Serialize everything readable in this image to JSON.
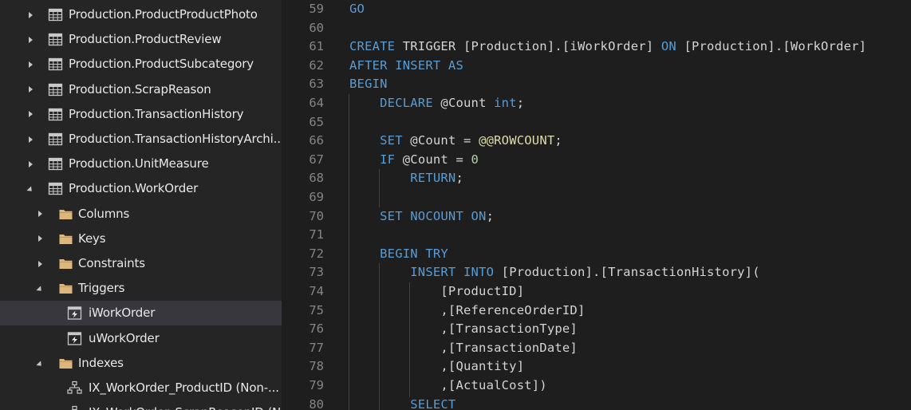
{
  "sidebar": {
    "items": [
      {
        "label": "Production.ProductProductPhoto",
        "icon": "table-icon",
        "expander": "collapsed",
        "level": 0
      },
      {
        "label": "Production.ProductReview",
        "icon": "table-icon",
        "expander": "collapsed",
        "level": 0
      },
      {
        "label": "Production.ProductSubcategory",
        "icon": "table-icon",
        "expander": "collapsed",
        "level": 0
      },
      {
        "label": "Production.ScrapReason",
        "icon": "table-icon",
        "expander": "collapsed",
        "level": 0
      },
      {
        "label": "Production.TransactionHistory",
        "icon": "table-icon",
        "expander": "collapsed",
        "level": 0
      },
      {
        "label": "Production.TransactionHistoryArchi...",
        "icon": "table-icon",
        "expander": "collapsed",
        "level": 0
      },
      {
        "label": "Production.UnitMeasure",
        "icon": "table-icon",
        "expander": "collapsed",
        "level": 0
      },
      {
        "label": "Production.WorkOrder",
        "icon": "table-icon",
        "expander": "expanded",
        "level": 0
      },
      {
        "label": "Columns",
        "icon": "folder-icon",
        "expander": "collapsed",
        "level": 1
      },
      {
        "label": "Keys",
        "icon": "folder-icon",
        "expander": "collapsed",
        "level": 1
      },
      {
        "label": "Constraints",
        "icon": "folder-icon",
        "expander": "collapsed",
        "level": 1
      },
      {
        "label": "Triggers",
        "icon": "folder-icon",
        "expander": "expanded",
        "level": 1
      },
      {
        "label": "iWorkOrder",
        "icon": "trigger-icon",
        "expander": "none",
        "level": 2,
        "selected": true
      },
      {
        "label": "uWorkOrder",
        "icon": "trigger-icon",
        "expander": "none",
        "level": 2
      },
      {
        "label": "Indexes",
        "icon": "folder-icon",
        "expander": "expanded",
        "level": 1
      },
      {
        "label": "IX_WorkOrder_ProductID (Non-...",
        "icon": "index-icon",
        "expander": "none",
        "level": 2
      },
      {
        "label": "IX_WorkOrder_ScrapReasonID (Non-...",
        "icon": "index-icon",
        "expander": "none",
        "level": 2
      }
    ]
  },
  "editor": {
    "lines": [
      {
        "n": "59",
        "tokens": [
          {
            "t": "GO",
            "c": "kw"
          }
        ]
      },
      {
        "n": "60",
        "tokens": []
      },
      {
        "n": "61",
        "tokens": [
          {
            "t": "CREATE",
            "c": "kw"
          },
          {
            "t": " TRIGGER [Production].[iWorkOrder] ",
            "c": "txt"
          },
          {
            "t": "ON",
            "c": "kw"
          },
          {
            "t": " [Production].[WorkOrder]",
            "c": "txt"
          }
        ]
      },
      {
        "n": "62",
        "tokens": [
          {
            "t": "AFTER INSERT AS",
            "c": "kw"
          }
        ]
      },
      {
        "n": "63",
        "tokens": [
          {
            "t": "BEGIN",
            "c": "kw"
          }
        ]
      },
      {
        "n": "64",
        "tokens": [
          {
            "t": "    ",
            "c": "txt"
          },
          {
            "t": "DECLARE",
            "c": "kw"
          },
          {
            "t": " @Count ",
            "c": "txt"
          },
          {
            "t": "int",
            "c": "kw"
          },
          {
            "t": ";",
            "c": "txt"
          }
        ]
      },
      {
        "n": "65",
        "tokens": []
      },
      {
        "n": "66",
        "tokens": [
          {
            "t": "    ",
            "c": "txt"
          },
          {
            "t": "SET",
            "c": "kw"
          },
          {
            "t": " @Count = ",
            "c": "txt"
          },
          {
            "t": "@@ROWCOUNT",
            "c": "fn"
          },
          {
            "t": ";",
            "c": "txt"
          }
        ]
      },
      {
        "n": "67",
        "tokens": [
          {
            "t": "    ",
            "c": "txt"
          },
          {
            "t": "IF",
            "c": "kw"
          },
          {
            "t": " @Count = ",
            "c": "txt"
          },
          {
            "t": "0",
            "c": "num"
          }
        ]
      },
      {
        "n": "68",
        "tokens": [
          {
            "t": "        ",
            "c": "txt"
          },
          {
            "t": "RETURN",
            "c": "kw"
          },
          {
            "t": ";",
            "c": "txt"
          }
        ]
      },
      {
        "n": "69",
        "tokens": []
      },
      {
        "n": "70",
        "tokens": [
          {
            "t": "    ",
            "c": "txt"
          },
          {
            "t": "SET NOCOUNT ON",
            "c": "kw"
          },
          {
            "t": ";",
            "c": "txt"
          }
        ]
      },
      {
        "n": "71",
        "tokens": []
      },
      {
        "n": "72",
        "tokens": [
          {
            "t": "    ",
            "c": "txt"
          },
          {
            "t": "BEGIN TRY",
            "c": "kw"
          }
        ]
      },
      {
        "n": "73",
        "tokens": [
          {
            "t": "        ",
            "c": "txt"
          },
          {
            "t": "INSERT INTO",
            "c": "kw"
          },
          {
            "t": " [Production].[TransactionHistory](",
            "c": "txt"
          }
        ]
      },
      {
        "n": "74",
        "tokens": [
          {
            "t": "            [ProductID]",
            "c": "txt"
          }
        ]
      },
      {
        "n": "75",
        "tokens": [
          {
            "t": "            ,[ReferenceOrderID]",
            "c": "txt"
          }
        ]
      },
      {
        "n": "76",
        "tokens": [
          {
            "t": "            ,[TransactionType]",
            "c": "txt"
          }
        ]
      },
      {
        "n": "77",
        "tokens": [
          {
            "t": "            ,[TransactionDate]",
            "c": "txt"
          }
        ]
      },
      {
        "n": "78",
        "tokens": [
          {
            "t": "            ,[Quantity]",
            "c": "txt"
          }
        ]
      },
      {
        "n": "79",
        "tokens": [
          {
            "t": "            ,[ActualCost])",
            "c": "txt"
          }
        ]
      },
      {
        "n": "80",
        "tokens": [
          {
            "t": "        ",
            "c": "txt"
          },
          {
            "t": "SELECT",
            "c": "kw"
          }
        ]
      }
    ]
  },
  "colors": {
    "sidebar_bg": "#252526",
    "selected_bg": "#37373d",
    "editor_bg": "#1e1e1e",
    "keyword": "#569cd6",
    "function": "#dcdcaa",
    "number": "#b5cea8",
    "text": "#d4d4d4",
    "line_number": "#858585",
    "folder": "#dcb67a"
  }
}
